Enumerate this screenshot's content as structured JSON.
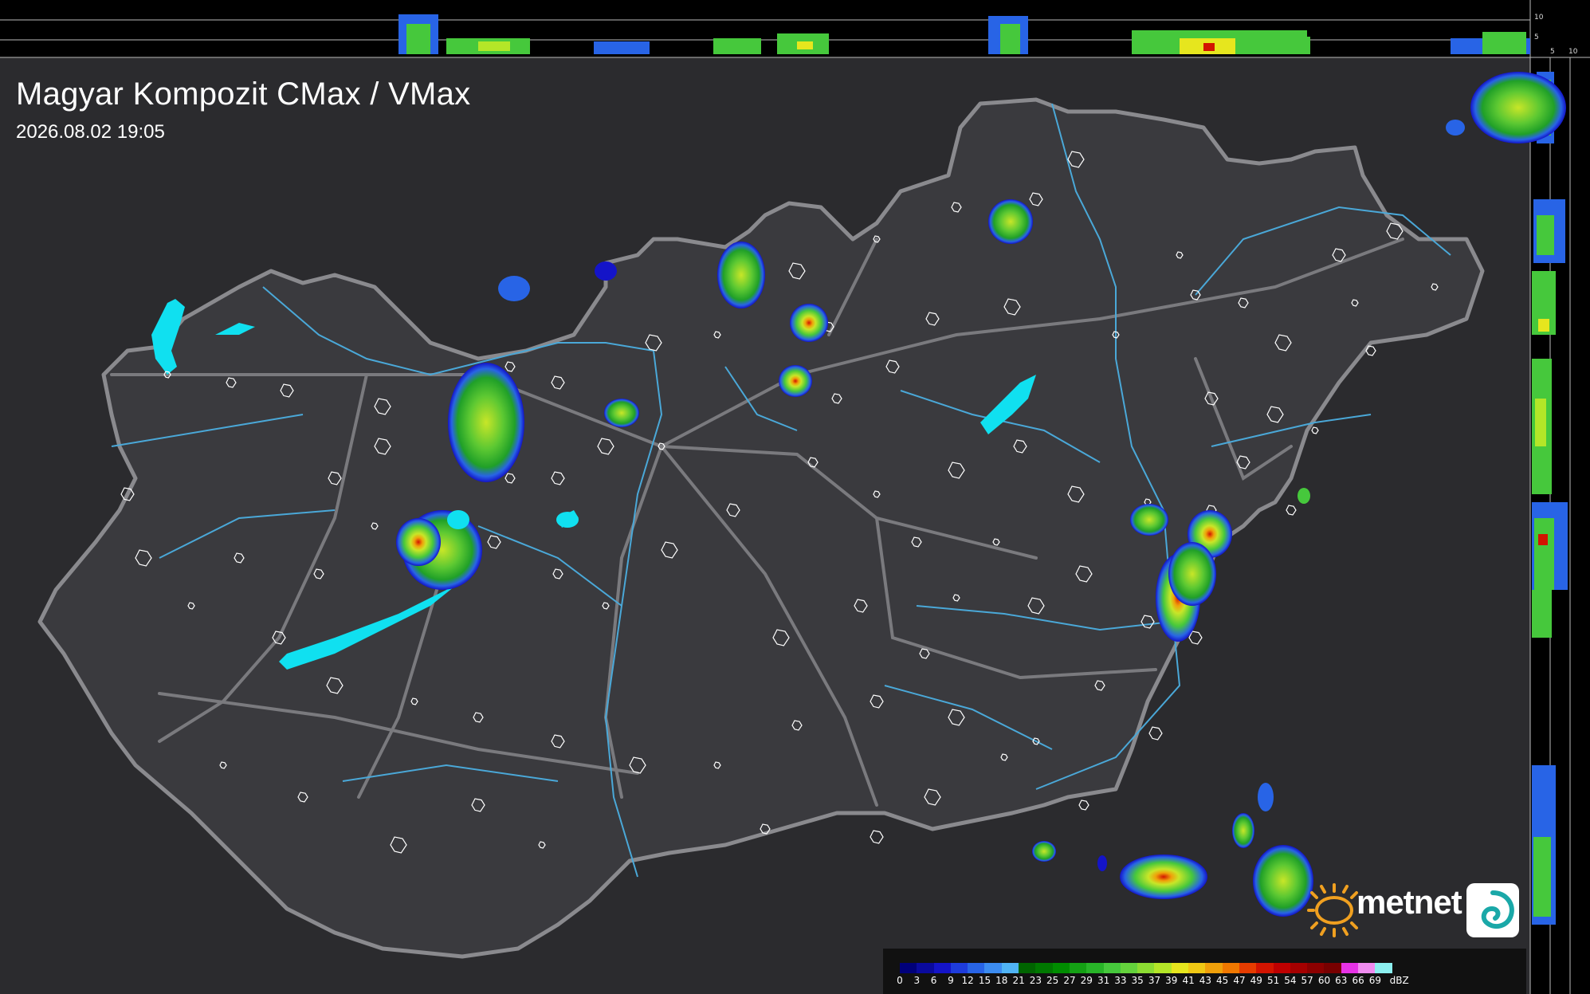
{
  "header": {
    "title": "Magyar Kompozit CMax / VMax",
    "timestamp": "2026.08.02 19:05"
  },
  "side_scale": {
    "top_ticks": [
      "10",
      "5"
    ],
    "right_ticks": [
      "5",
      "10"
    ]
  },
  "logo": {
    "brand": "metnet"
  },
  "legend": {
    "unit": "dBZ",
    "labels": [
      "0",
      "3",
      "6",
      "9",
      "12",
      "15",
      "18",
      "21",
      "23",
      "25",
      "27",
      "29",
      "31",
      "33",
      "35",
      "37",
      "39",
      "41",
      "43",
      "45",
      "47",
      "49",
      "51",
      "54",
      "57",
      "60",
      "63",
      "66",
      "69"
    ],
    "colors": [
      "#00007a",
      "#0a0a9e",
      "#1414c8",
      "#1e3cdc",
      "#2864e6",
      "#3c8cf0",
      "#50b4f5",
      "#006400",
      "#007800",
      "#008c00",
      "#14a014",
      "#28b428",
      "#46c83c",
      "#64d23c",
      "#8cdc32",
      "#b4e628",
      "#e6e61e",
      "#f0c814",
      "#f0a00a",
      "#f07800",
      "#e63c00",
      "#d21400",
      "#be0000",
      "#a50000",
      "#8c0000",
      "#780000",
      "#e632e6",
      "#f08cf0",
      "#8cf0f0"
    ]
  },
  "colors": {
    "background": "#000000",
    "land": "#3a3a3e",
    "country": "#444448",
    "border": "#8a8a8e",
    "roads": "#7a7a7e",
    "rivers": "#4aa8d8",
    "lakes": "#10e0f0",
    "brand_orange": "#f0a020"
  },
  "map": {
    "cities": [
      [
        210,
        470
      ],
      [
        290,
        480
      ],
      [
        360,
        490
      ],
      [
        480,
        510
      ],
      [
        570,
        505
      ],
      [
        640,
        460
      ],
      [
        700,
        480
      ],
      [
        820,
        430
      ],
      [
        900,
        420
      ],
      [
        1040,
        410
      ],
      [
        1170,
        400
      ],
      [
        1270,
        385
      ],
      [
        1400,
        420
      ],
      [
        1500,
        370
      ],
      [
        1520,
        500
      ],
      [
        1610,
        430
      ],
      [
        1700,
        380
      ],
      [
        1720,
        440
      ],
      [
        1280,
        560
      ],
      [
        1200,
        590
      ],
      [
        1100,
        620
      ],
      [
        1020,
        580
      ],
      [
        920,
        640
      ],
      [
        840,
        690
      ],
      [
        760,
        760
      ],
      [
        700,
        720
      ],
      [
        620,
        680
      ],
      [
        550,
        700
      ],
      [
        470,
        660
      ],
      [
        400,
        720
      ],
      [
        350,
        800
      ],
      [
        420,
        860
      ],
      [
        520,
        880
      ],
      [
        600,
        900
      ],
      [
        700,
        930
      ],
      [
        800,
        960
      ],
      [
        900,
        960
      ],
      [
        1000,
        910
      ],
      [
        1100,
        880
      ],
      [
        1200,
        900
      ],
      [
        1300,
        930
      ],
      [
        1380,
        860
      ],
      [
        1440,
        780
      ],
      [
        1300,
        760
      ],
      [
        1200,
        750
      ],
      [
        1160,
        820
      ],
      [
        1080,
        760
      ],
      [
        980,
        800
      ],
      [
        280,
        960
      ],
      [
        380,
        1000
      ],
      [
        600,
        1010
      ],
      [
        500,
        1060
      ],
      [
        680,
        1060
      ],
      [
        960,
        1040
      ],
      [
        1100,
        1050
      ],
      [
        1170,
        1000
      ],
      [
        1260,
        950
      ],
      [
        1360,
        1010
      ],
      [
        1450,
        920
      ],
      [
        1350,
        620
      ],
      [
        1440,
        630
      ],
      [
        1520,
        640
      ],
      [
        1560,
        580
      ],
      [
        1600,
        520
      ],
      [
        1650,
        540
      ],
      [
        1620,
        640
      ],
      [
        1500,
        800
      ],
      [
        1360,
        720
      ],
      [
        1250,
        680
      ],
      [
        1150,
        680
      ],
      [
        160,
        620
      ],
      [
        180,
        700
      ],
      [
        240,
        760
      ],
      [
        300,
        700
      ],
      [
        420,
        600
      ],
      [
        480,
        560
      ],
      [
        600,
        560
      ],
      [
        640,
        600
      ],
      [
        700,
        600
      ],
      [
        760,
        560
      ],
      [
        830,
        560
      ],
      [
        1050,
        500
      ],
      [
        1120,
        460
      ],
      [
        1000,
        340
      ],
      [
        1100,
        300
      ],
      [
        1200,
        260
      ],
      [
        1300,
        250
      ],
      [
        1350,
        200
      ],
      [
        1480,
        320
      ],
      [
        1560,
        380
      ],
      [
        1680,
        320
      ],
      [
        1750,
        290
      ],
      [
        1800,
        360
      ]
    ]
  }
}
